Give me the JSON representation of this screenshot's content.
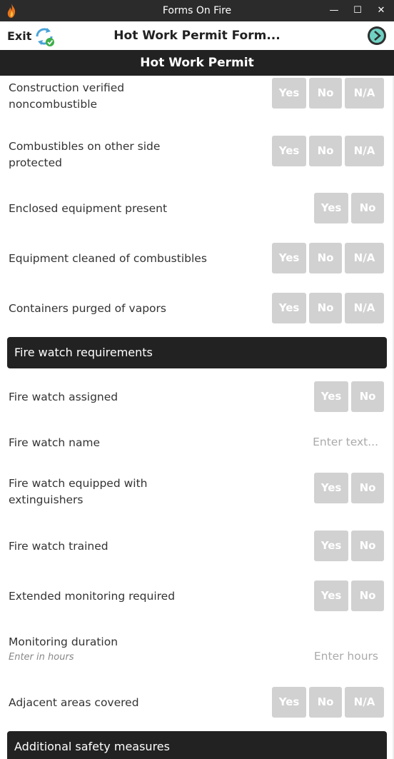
{
  "window": {
    "title": "Forms On Fire",
    "minimize": "—",
    "maximize": "☐",
    "close": "✕"
  },
  "appbar": {
    "exit_label": "Exit",
    "form_title": "Hot Work Permit Form..."
  },
  "section": {
    "title": "Hot Work Permit"
  },
  "questions": [
    {
      "label": "Construction verified noncombustible",
      "options": [
        "Yes",
        "No",
        "N/A"
      ]
    },
    {
      "label": "Combustibles on other side protected",
      "options": [
        "Yes",
        "No",
        "N/A"
      ]
    },
    {
      "label": "Enclosed equipment present",
      "options": [
        "Yes",
        "No"
      ]
    },
    {
      "label": "Equipment cleaned of combustibles",
      "options": [
        "Yes",
        "No",
        "N/A"
      ]
    },
    {
      "label": "Containers purged of vapors",
      "options": [
        "Yes",
        "No",
        "N/A"
      ]
    }
  ],
  "group1": {
    "title": "Fire watch requirements"
  },
  "fire_watch": [
    {
      "label": "Fire watch assigned",
      "options": [
        "Yes",
        "No"
      ]
    },
    {
      "label": "Fire watch name",
      "placeholder": "Enter text..."
    },
    {
      "label": "Fire watch equipped with extinguishers",
      "options": [
        "Yes",
        "No"
      ]
    },
    {
      "label": "Fire watch trained",
      "options": [
        "Yes",
        "No"
      ]
    },
    {
      "label": "Extended monitoring required",
      "options": [
        "Yes",
        "No"
      ]
    },
    {
      "label": "Monitoring duration",
      "hint": "Enter in hours",
      "placeholder": "Enter hours"
    },
    {
      "label": "Adjacent areas covered",
      "options": [
        "Yes",
        "No",
        "N/A"
      ]
    }
  ],
  "group2": {
    "title": "Additional safety measures"
  }
}
